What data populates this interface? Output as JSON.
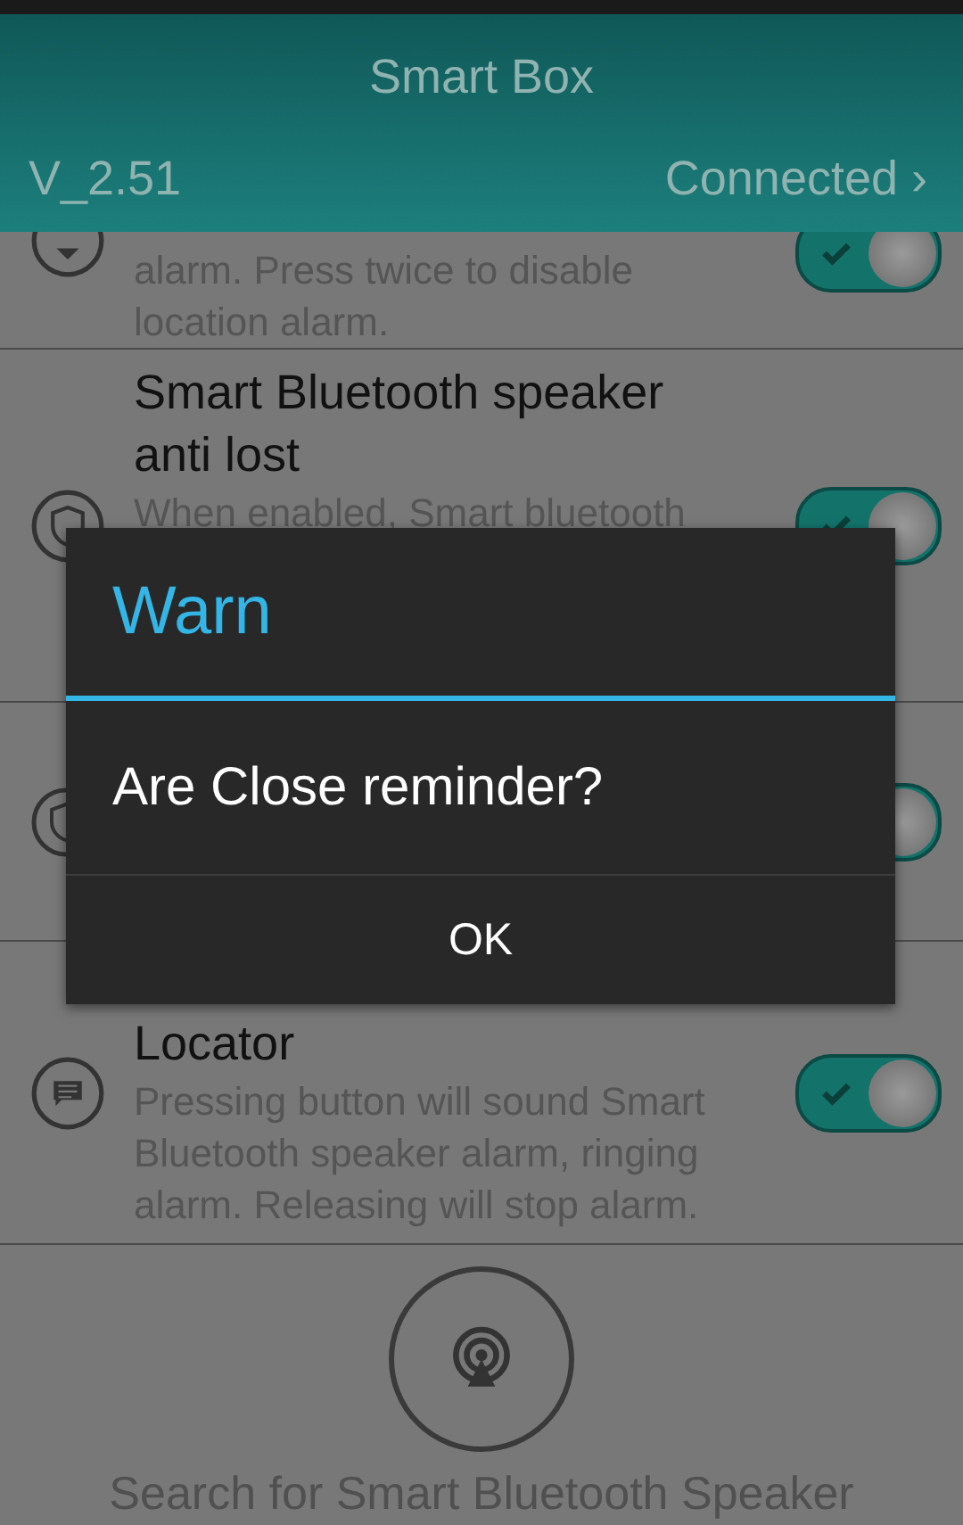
{
  "header": {
    "title": "Smart Box",
    "version": "V_2.51",
    "status": "Connected",
    "status_arrow": "›"
  },
  "items": [
    {
      "description": "alarm. Press twice to disable location alarm.",
      "on": true
    },
    {
      "title": "Smart Bluetooth speaker anti lost",
      "description": "When enabled, Smart bluetooth",
      "on": true
    },
    {
      "on": true
    },
    {
      "title": "Locator",
      "description": "Pressing button will sound Smart Bluetooth speaker alarm, ringing alarm. Releasing will stop alarm.",
      "on": true
    }
  ],
  "search": {
    "label": "Search for Smart Bluetooth Speaker"
  },
  "dialog": {
    "title": "Warn",
    "message": "Are Close reminder?",
    "button": "OK"
  }
}
